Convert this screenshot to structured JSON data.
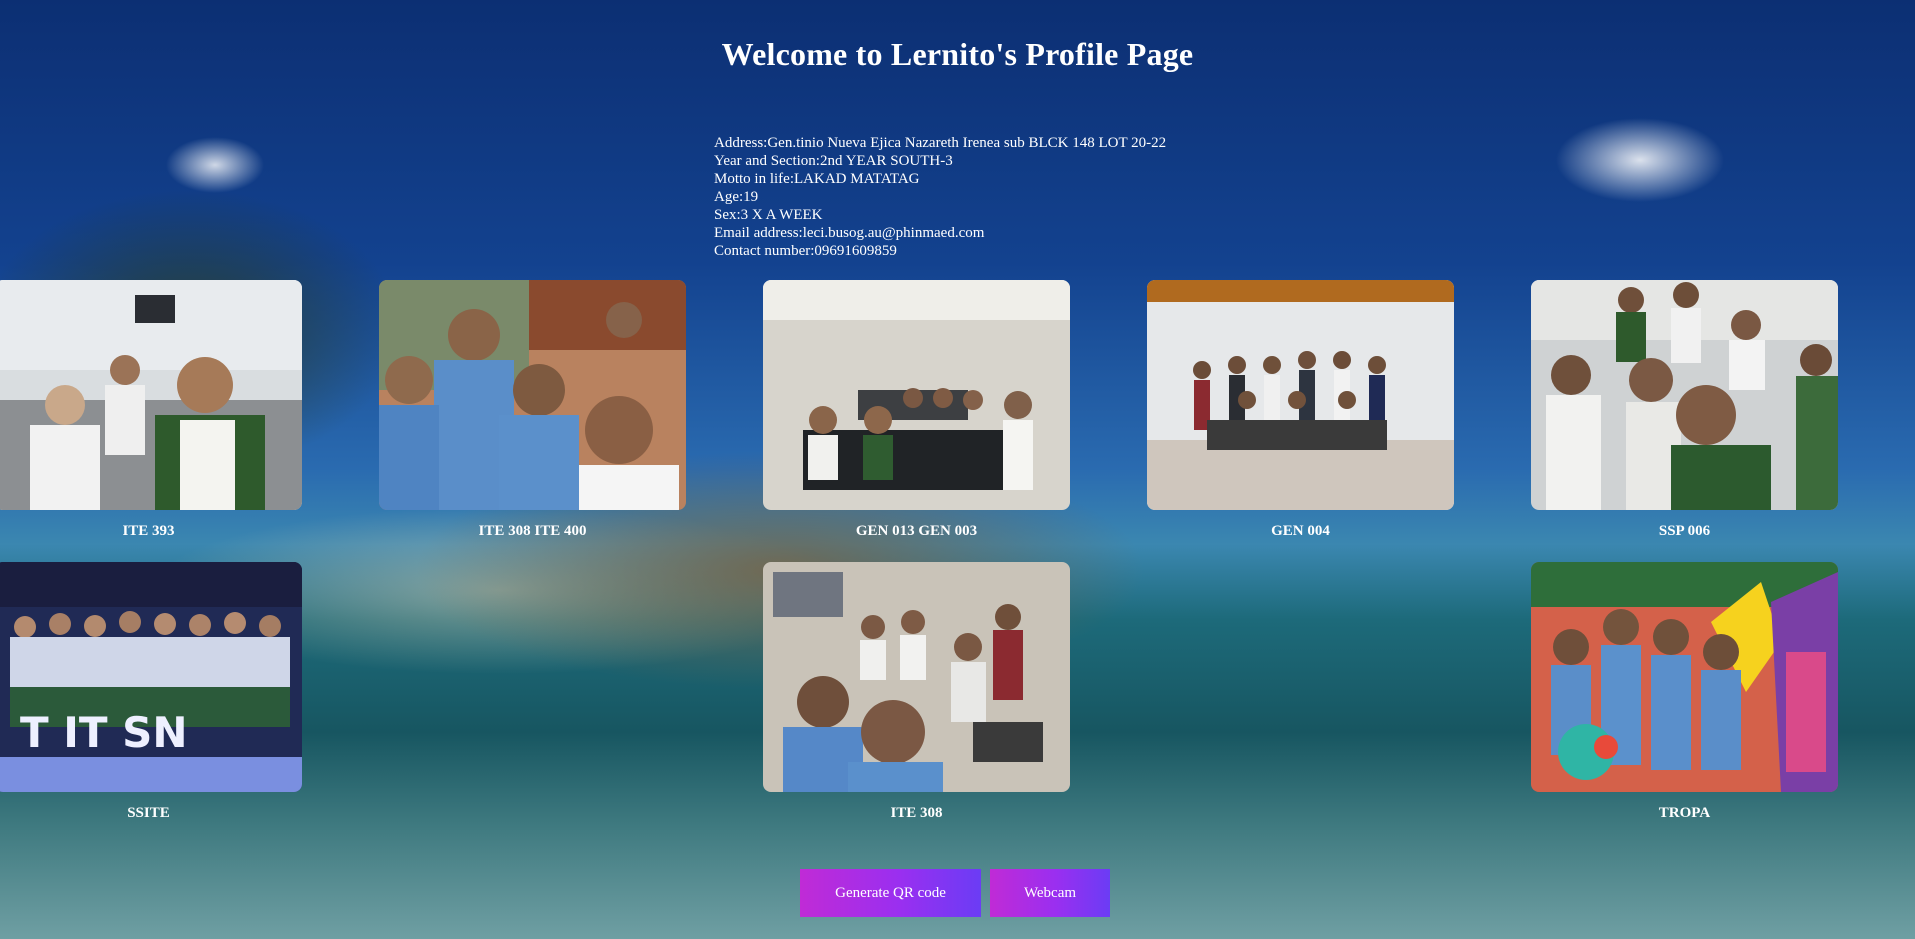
{
  "page": {
    "title": "Welcome to Lernito's Profile Page"
  },
  "profile": {
    "address": "Address:Gen.tinio Nueva Ejica Nazareth Irenea sub BLCK 148 LOT 20-22",
    "year_section": "Year and Section:2nd YEAR SOUTH-3",
    "motto": "Motto in life:LAKAD MATATAG",
    "age": "Age:19",
    "sex": "Sex:3 X A WEEK",
    "email": "Email address:leci.busog.au@phinmaed.com",
    "contact": "Contact number:09691609859"
  },
  "gallery": {
    "captions": {
      "ite393": "ITE 393",
      "ite308_400": "ITE 308 ITE 400",
      "gen013_003": "GEN 013 GEN 003",
      "gen004": "GEN 004",
      "ssp006": "SSP 006",
      "ssite": "SSITE",
      "ite308": "ITE 308",
      "tropa": "TROPA"
    }
  },
  "buttons": {
    "qr_label": "Generate QR code",
    "webcam_label": "Webcam"
  },
  "colors": {
    "button_gradient_start": "#c02bd6",
    "button_gradient_end": "#6b3cf5",
    "text": "#ffffff"
  }
}
